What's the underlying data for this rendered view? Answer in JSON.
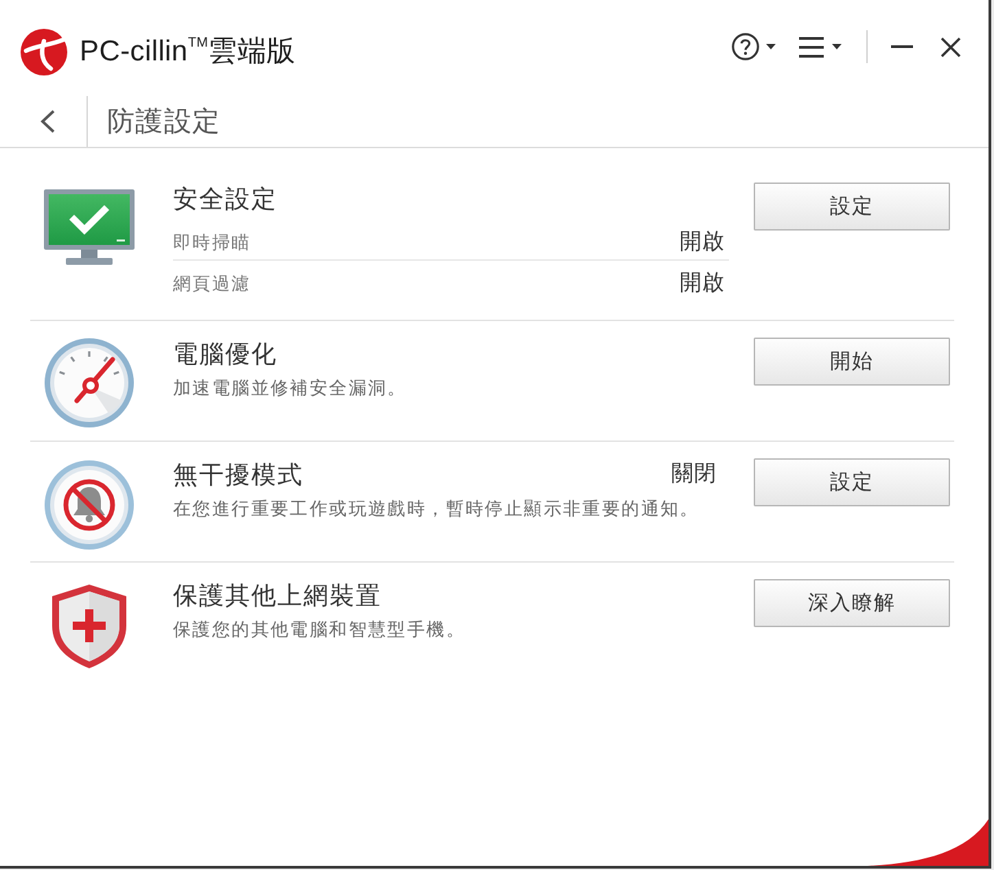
{
  "window": {
    "title": "PC-cillin$^{TM}$雲端版"
  },
  "page": {
    "title": "防護設定"
  },
  "sections": [
    {
      "kind": "security",
      "title": "安全設定",
      "settings": [
        {
          "label": "即時掃瞄",
          "status": "開啟"
        },
        {
          "label": "網頁過濾",
          "status": "開啟"
        }
      ],
      "button": "設定"
    },
    {
      "kind": "optimize",
      "title": "電腦優化",
      "description": "加速電腦並修補安全漏洞。",
      "button": "開始"
    },
    {
      "kind": "mute",
      "title": "無干擾模式",
      "status": "關閉",
      "description": "在您進行重要工作或玩遊戲時，暫時停止顯示非重要的通知。",
      "button": "設定"
    },
    {
      "kind": "devices",
      "title": "保護其他上網裝置",
      "description": "保護您的其他電腦和智慧型手機。",
      "button": "深入瞭解"
    }
  ]
}
